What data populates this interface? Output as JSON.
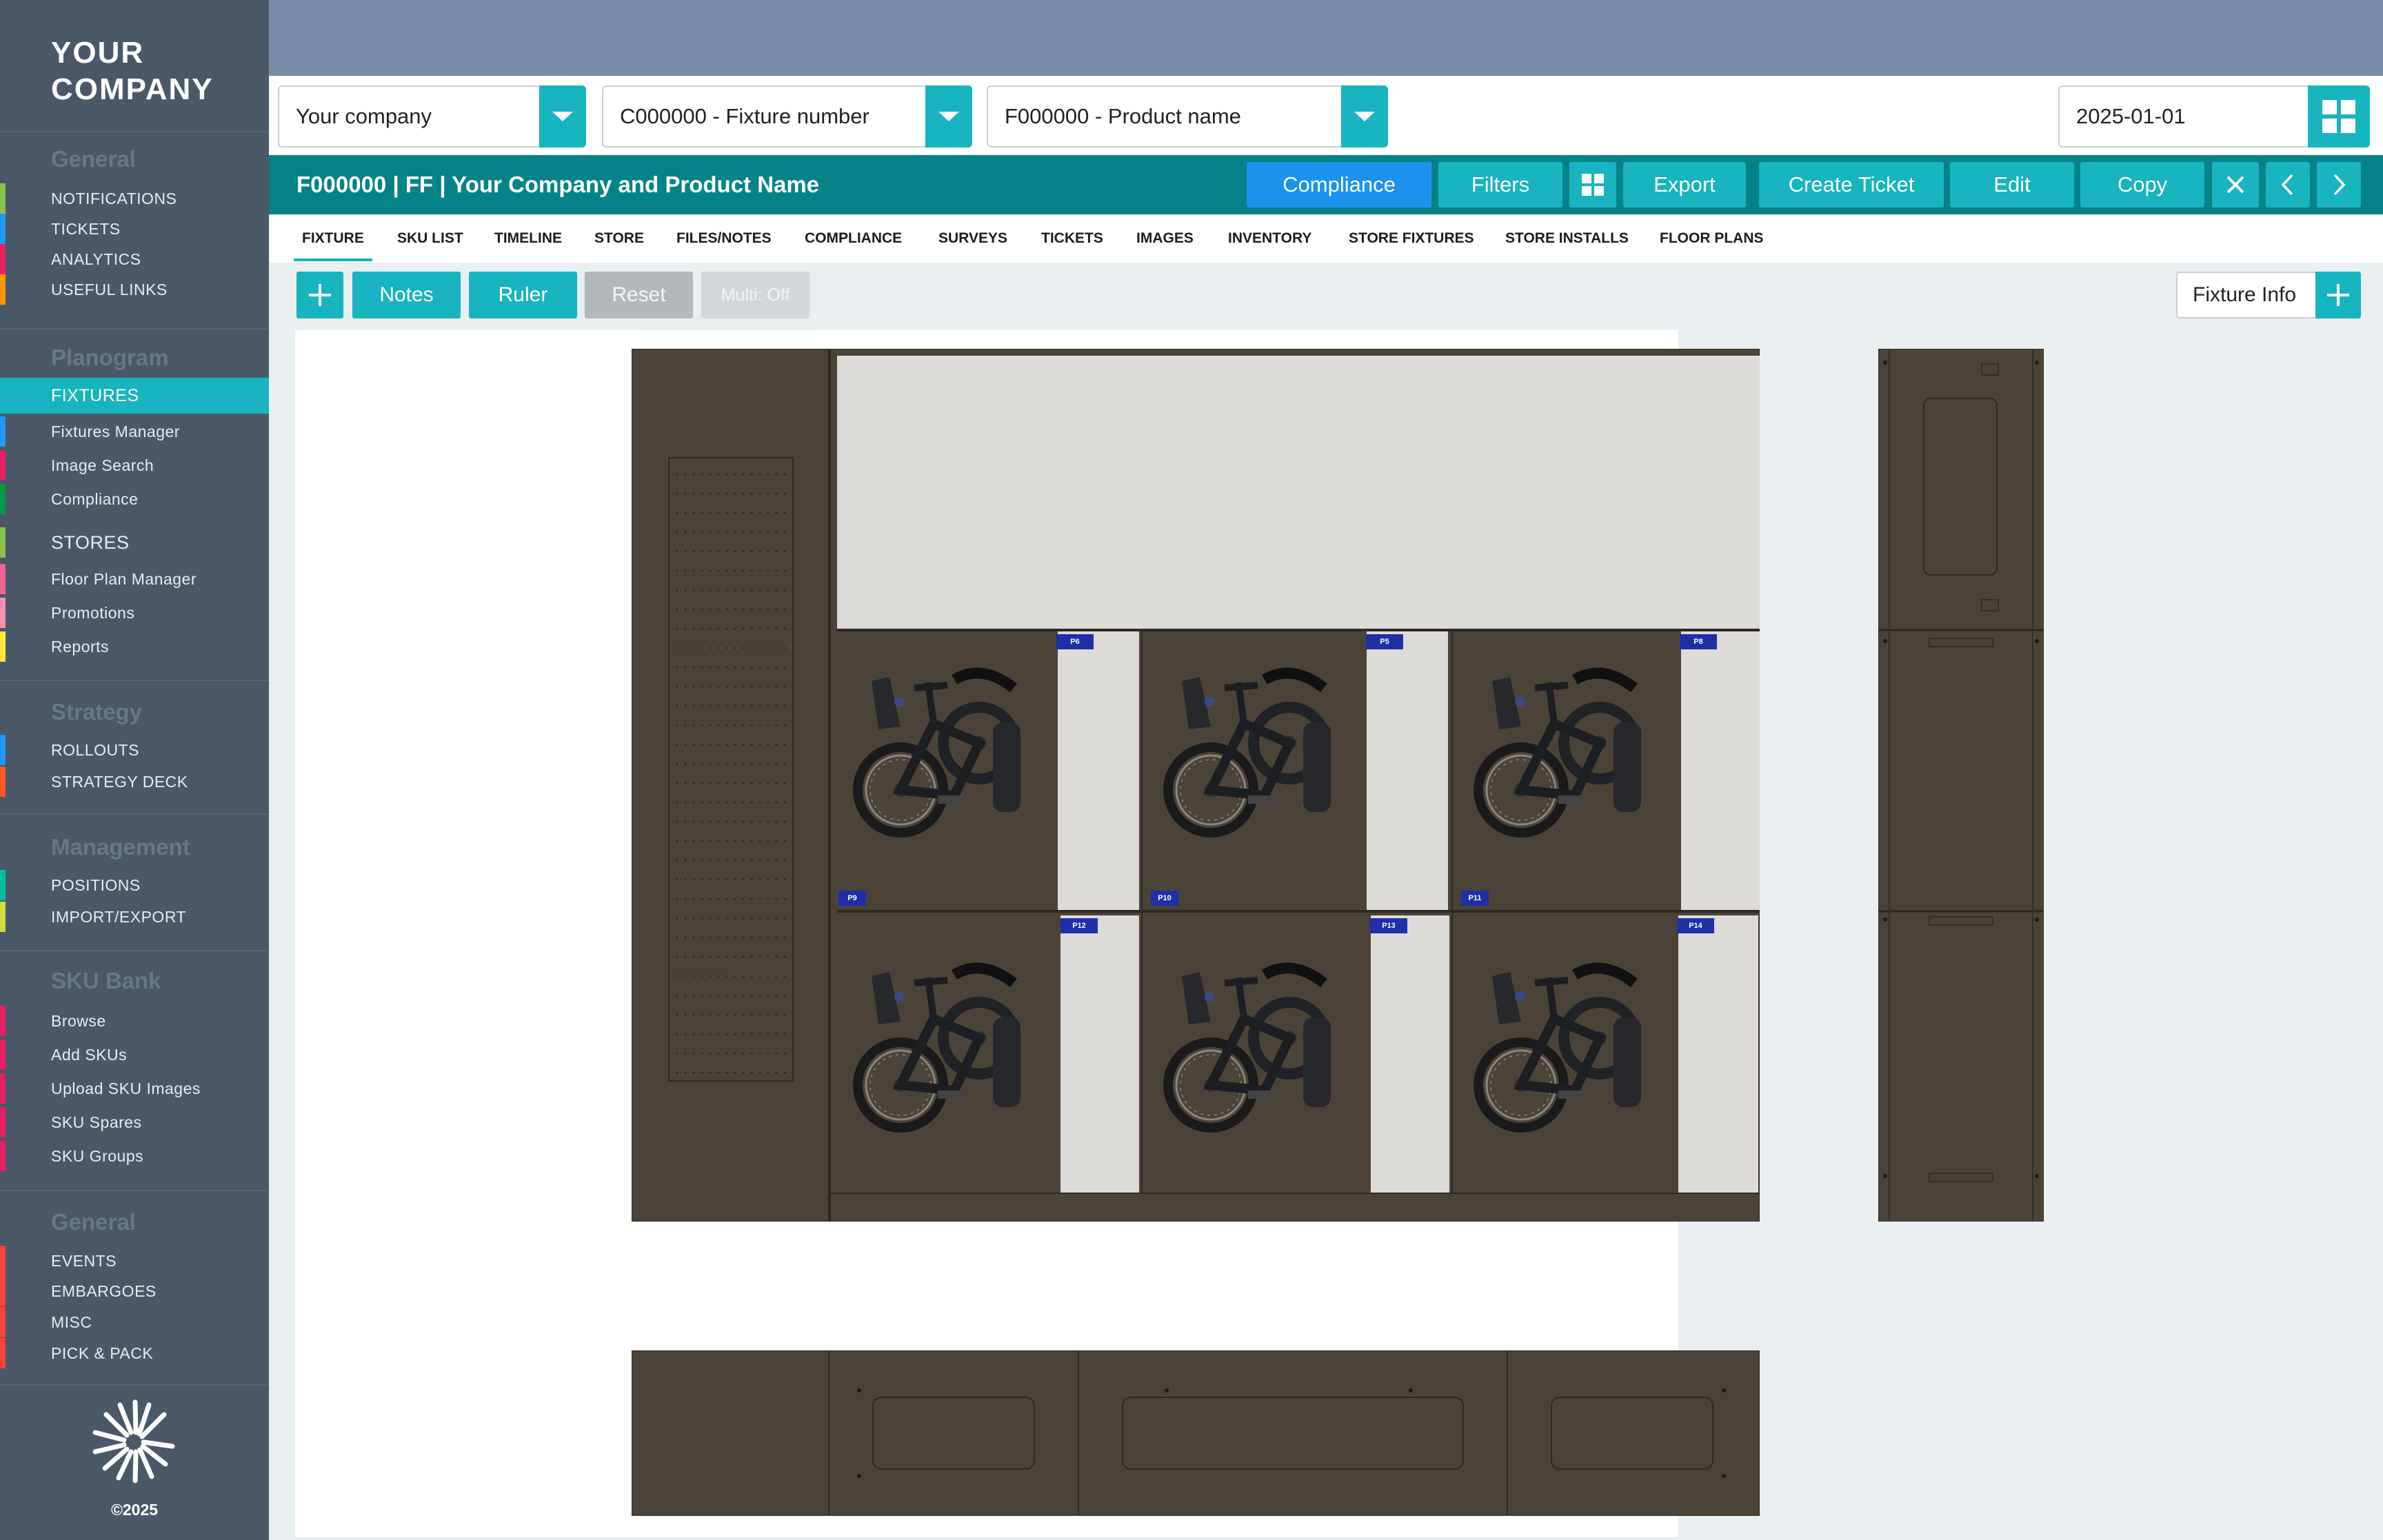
{
  "brand": {
    "name_line1": "YOUR",
    "name_line2": "COMPANY",
    "copyright": "©2025",
    "colors": {
      "accent": "#18b4bf",
      "sidebar": "#4a5868",
      "titlebar": "#068389",
      "compliance": "#1b93ee"
    }
  },
  "sidebar": {
    "sections": [
      {
        "title": "General",
        "items": [
          {
            "label": "NOTIFICATIONS",
            "color": "#8bc34a"
          },
          {
            "label": "TICKETS",
            "color": "#2196f3"
          },
          {
            "label": "ANALYTICS",
            "color": "#e91e63"
          },
          {
            "label": "USEFUL LINKS",
            "color": "#ff9800"
          }
        ]
      },
      {
        "title": "Planogram",
        "items": [
          {
            "label": "FIXTURES",
            "active": true
          },
          {
            "label": "Fixtures Manager",
            "color": "#2196f3"
          },
          {
            "label": "Image Search",
            "color": "#e91e63"
          },
          {
            "label": "Compliance",
            "color": "#009b4a"
          },
          {
            "label": "STORES",
            "color": "#8bc34a",
            "heading": true
          },
          {
            "label": "Floor Plan Manager",
            "color": "#f06292"
          },
          {
            "label": "Promotions",
            "color": "#f48fb1"
          },
          {
            "label": "Reports",
            "color": "#ffeb3b"
          }
        ]
      },
      {
        "title": "Strategy",
        "items": [
          {
            "label": "ROLLOUTS",
            "color": "#2196f3"
          },
          {
            "label": "STRATEGY DECK",
            "color": "#ff5722"
          }
        ]
      },
      {
        "title": "Management",
        "items": [
          {
            "label": "POSITIONS",
            "color": "#00bfa5"
          },
          {
            "label": "IMPORT/EXPORT",
            "color": "#cddc39"
          }
        ]
      },
      {
        "title": "SKU Bank",
        "items": [
          {
            "label": "Browse",
            "color": "#e91e63"
          },
          {
            "label": "Add SKUs",
            "color": "#e91e63"
          },
          {
            "label": "Upload SKU Images",
            "color": "#e91e63"
          },
          {
            "label": "SKU Spares",
            "color": "#e91e63"
          },
          {
            "label": "SKU Groups",
            "color": "#e91e63"
          }
        ]
      },
      {
        "title": "General",
        "items": [
          {
            "label": "EVENTS",
            "color": "#f44336"
          },
          {
            "label": "EMBARGOES",
            "color": "#f44336"
          },
          {
            "label": "MISC",
            "color": "#f44336"
          },
          {
            "label": "PICK & PACK",
            "color": "#f44336"
          }
        ]
      }
    ]
  },
  "selectors": {
    "company": "Your company",
    "fixture": "C000000 - Fixture number",
    "product": "F000000 - Product name",
    "date": "2025-01-01"
  },
  "titlebar": {
    "title": "F000000 | FF | Your Company and Product Name",
    "buttons": {
      "compliance": "Compliance",
      "filters": "Filters",
      "export": "Export",
      "create_ticket": "Create Ticket",
      "edit": "Edit",
      "copy": "Copy"
    }
  },
  "tabs": [
    "FIXTURE",
    "SKU LIST",
    "TIMELINE",
    "STORE",
    "FILES/NOTES",
    "COMPLIANCE",
    "SURVEYS",
    "TICKETS",
    "IMAGES",
    "INVENTORY",
    "STORE FIXTURES",
    "STORE INSTALLS",
    "FLOOR PLANS"
  ],
  "toolbar": {
    "notes": "Notes",
    "ruler": "Ruler",
    "reset": "Reset",
    "multi": "Multi: Off",
    "fixture_info": "Fixture Info"
  },
  "positions": {
    "top_row": [
      "P6",
      "P5",
      "P8"
    ],
    "top_row_bottom": [
      "P9",
      "P10",
      "P11"
    ],
    "bottom_row": [
      "P12",
      "P13",
      "P14"
    ]
  }
}
